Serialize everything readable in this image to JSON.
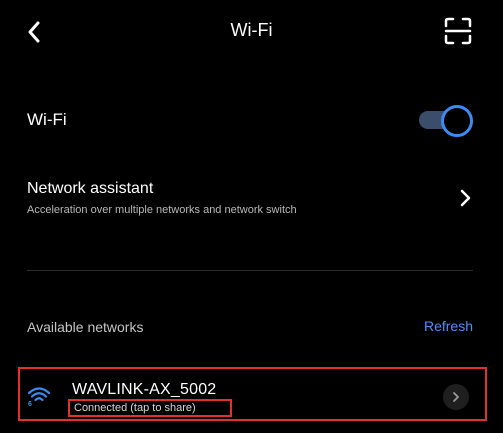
{
  "header": {
    "title": "Wi-Fi",
    "back_icon": "back-arrow-icon",
    "scan_icon": "qr-scan-icon"
  },
  "wifi_toggle": {
    "label": "Wi-Fi",
    "enabled": true,
    "accent_color": "#3b8bf2"
  },
  "network_assistant": {
    "title": "Network assistant",
    "subtitle": "Acceleration over multiple networks and network switch"
  },
  "available_networks": {
    "label": "Available networks",
    "refresh_label": "Refresh",
    "items": [
      {
        "name": "WAVLINK-AX_5002",
        "status": "Connected (tap to share)",
        "icon": "wifi6-signal-icon"
      }
    ]
  },
  "colors": {
    "background": "#000000",
    "link": "#4b90f5",
    "highlight_border": "#e0312b"
  }
}
